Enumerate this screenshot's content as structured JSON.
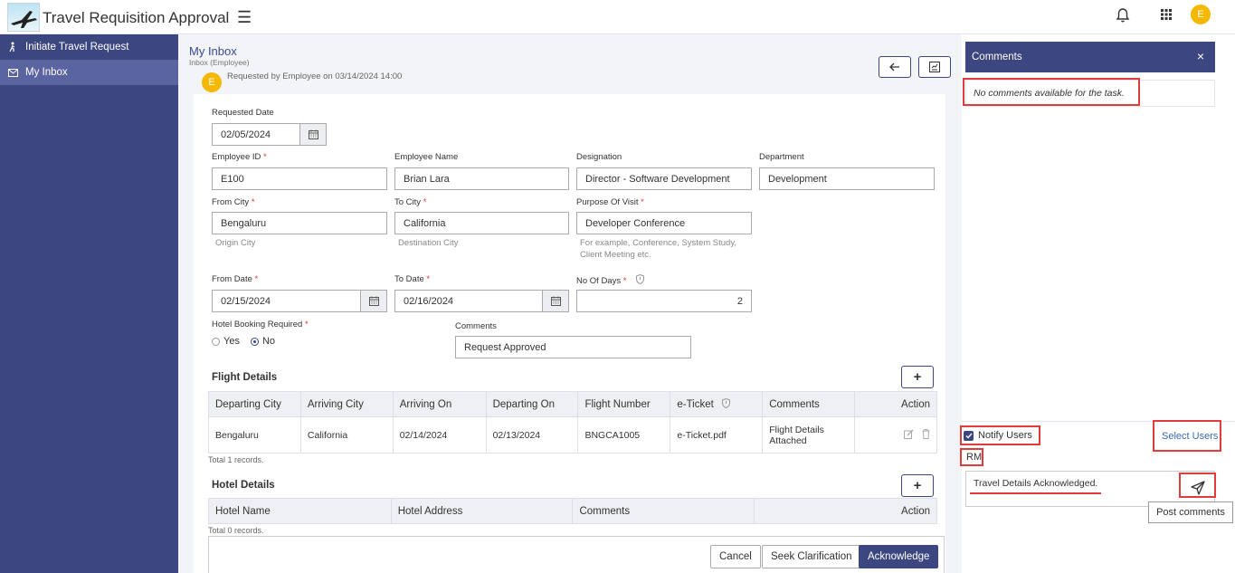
{
  "app": {
    "title": "Travel Requisition Approval",
    "avatar": "E"
  },
  "sidebar": {
    "items": [
      {
        "label": "Initiate Travel Request",
        "icon": "walking-person-icon"
      },
      {
        "label": "My Inbox",
        "icon": "mail-icon"
      }
    ]
  },
  "main": {
    "title": "My Inbox",
    "subtitle": "Inbox (Employee)",
    "requester_avatar": "E",
    "requested_by": "Requested by Employee on 03/14/2024 14:00"
  },
  "form": {
    "requested_date": {
      "label": "Requested Date",
      "value": "02/05/2024"
    },
    "employee_id": {
      "label": "Employee ID",
      "value": "E100"
    },
    "employee_name": {
      "label": "Employee Name",
      "value": "Brian Lara"
    },
    "designation": {
      "label": "Designation",
      "value": "Director - Software Development"
    },
    "department": {
      "label": "Department",
      "value": "Development"
    },
    "from_city": {
      "label": "From City",
      "value": "Bengaluru",
      "hint": "Origin City"
    },
    "to_city": {
      "label": "To City",
      "value": "California",
      "hint": "Destination City"
    },
    "purpose": {
      "label": "Purpose Of Visit",
      "value": "Developer Conference",
      "hint": "For example, Conference, System Study, Client Meeting etc."
    },
    "from_date": {
      "label": "From Date",
      "value": "02/15/2024"
    },
    "to_date": {
      "label": "To Date",
      "value": "02/16/2024"
    },
    "no_of_days": {
      "label": "No Of Days",
      "value": "2"
    },
    "hotel_booking": {
      "label": "Hotel Booking Required",
      "yes": "Yes",
      "no": "No",
      "selected": "No"
    },
    "comments": {
      "label": "Comments",
      "value": "Request Approved"
    },
    "required_mark": "*"
  },
  "flight": {
    "title": "Flight Details",
    "add_label": "+",
    "columns": [
      "Departing City",
      "Arriving City",
      "Arriving On",
      "Departing On",
      "Flight Number",
      "e-Ticket",
      "Comments",
      "Action"
    ],
    "rows": [
      {
        "departing_city": "Bengaluru",
        "arriving_city": "California",
        "arriving_on": "02/14/2024",
        "departing_on": "02/13/2024",
        "flight_number": "BNGCA1005",
        "e_ticket": "e-Ticket.pdf",
        "comments": "Flight Details Attached"
      }
    ],
    "total": "Total 1 records."
  },
  "hotel": {
    "title": "Hotel Details",
    "add_label": "+",
    "columns": [
      "Hotel Name",
      "Hotel Address",
      "Comments",
      "Action"
    ],
    "total": "Total 0 records."
  },
  "footer": {
    "cancel": "Cancel",
    "seek": "Seek Clarification",
    "acknowledge": "Acknowledge"
  },
  "comments_panel": {
    "title": "Comments",
    "close": "×",
    "empty": "No comments available for the task.",
    "notify": "Notify Users",
    "select_users": "Select Users",
    "recipient": "RM",
    "input_value": "Travel Details Acknowledged.",
    "tooltip": "Post comments"
  },
  "colors": {
    "brand": "#3c4680",
    "avatar": "#f5b800",
    "highlight": "#e03c3c",
    "link": "#3a6ab0"
  }
}
